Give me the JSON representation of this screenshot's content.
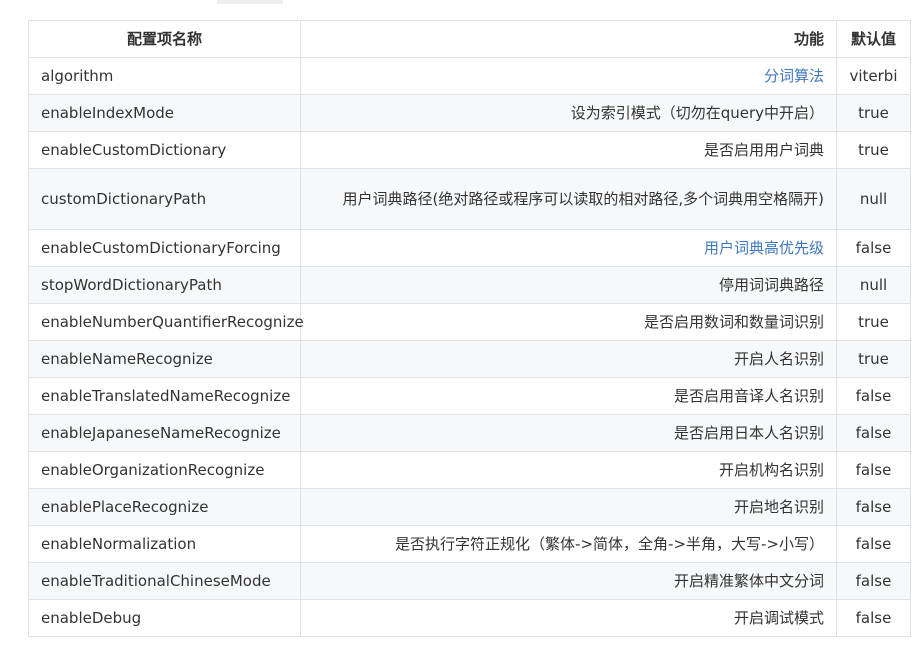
{
  "header": {
    "name": "配置项名称",
    "func": "功能",
    "def": "默认值"
  },
  "rows": [
    {
      "name": "algorithm",
      "func": "分词算法",
      "def": "viterbi",
      "link": true
    },
    {
      "name": "enableIndexMode",
      "func": "设为索引模式（切勿在query中开启）",
      "def": "true",
      "link": false
    },
    {
      "name": "enableCustomDictionary",
      "func": "是否启用用户词典",
      "def": "true",
      "link": false
    },
    {
      "name": "customDictionaryPath",
      "func": "用户词典路径(绝对路径或程序可以读取的相对路径,多个词典用空格隔开)",
      "def": "null",
      "link": false
    },
    {
      "name": "enableCustomDictionaryForcing",
      "func": "用户词典高优先级",
      "def": "false",
      "link": true
    },
    {
      "name": "stopWordDictionaryPath",
      "func": "停用词词典路径",
      "def": "null",
      "link": false
    },
    {
      "name": "enableNumberQuantifierRecognize",
      "func": "是否启用数词和数量词识别",
      "def": "true",
      "link": false
    },
    {
      "name": "enableNameRecognize",
      "func": "开启人名识别",
      "def": "true",
      "link": false
    },
    {
      "name": "enableTranslatedNameRecognize",
      "func": "是否启用音译人名识别",
      "def": "false",
      "link": false
    },
    {
      "name": "enableJapaneseNameRecognize",
      "func": "是否启用日本人名识别",
      "def": "false",
      "link": false
    },
    {
      "name": "enableOrganizationRecognize",
      "func": "开启机构名识别",
      "def": "false",
      "link": false
    },
    {
      "name": "enablePlaceRecognize",
      "func": "开启地名识别",
      "def": "false",
      "link": false
    },
    {
      "name": "enableNormalization",
      "func": "是否执行字符正规化（繁体->简体，全角->半角，大写->小写）",
      "def": "false",
      "link": false
    },
    {
      "name": "enableTraditionalChineseMode",
      "func": "开启精准繁体中文分词",
      "def": "false",
      "link": false
    },
    {
      "name": "enableDebug",
      "func": "开启调试模式",
      "def": "false",
      "link": false
    }
  ]
}
